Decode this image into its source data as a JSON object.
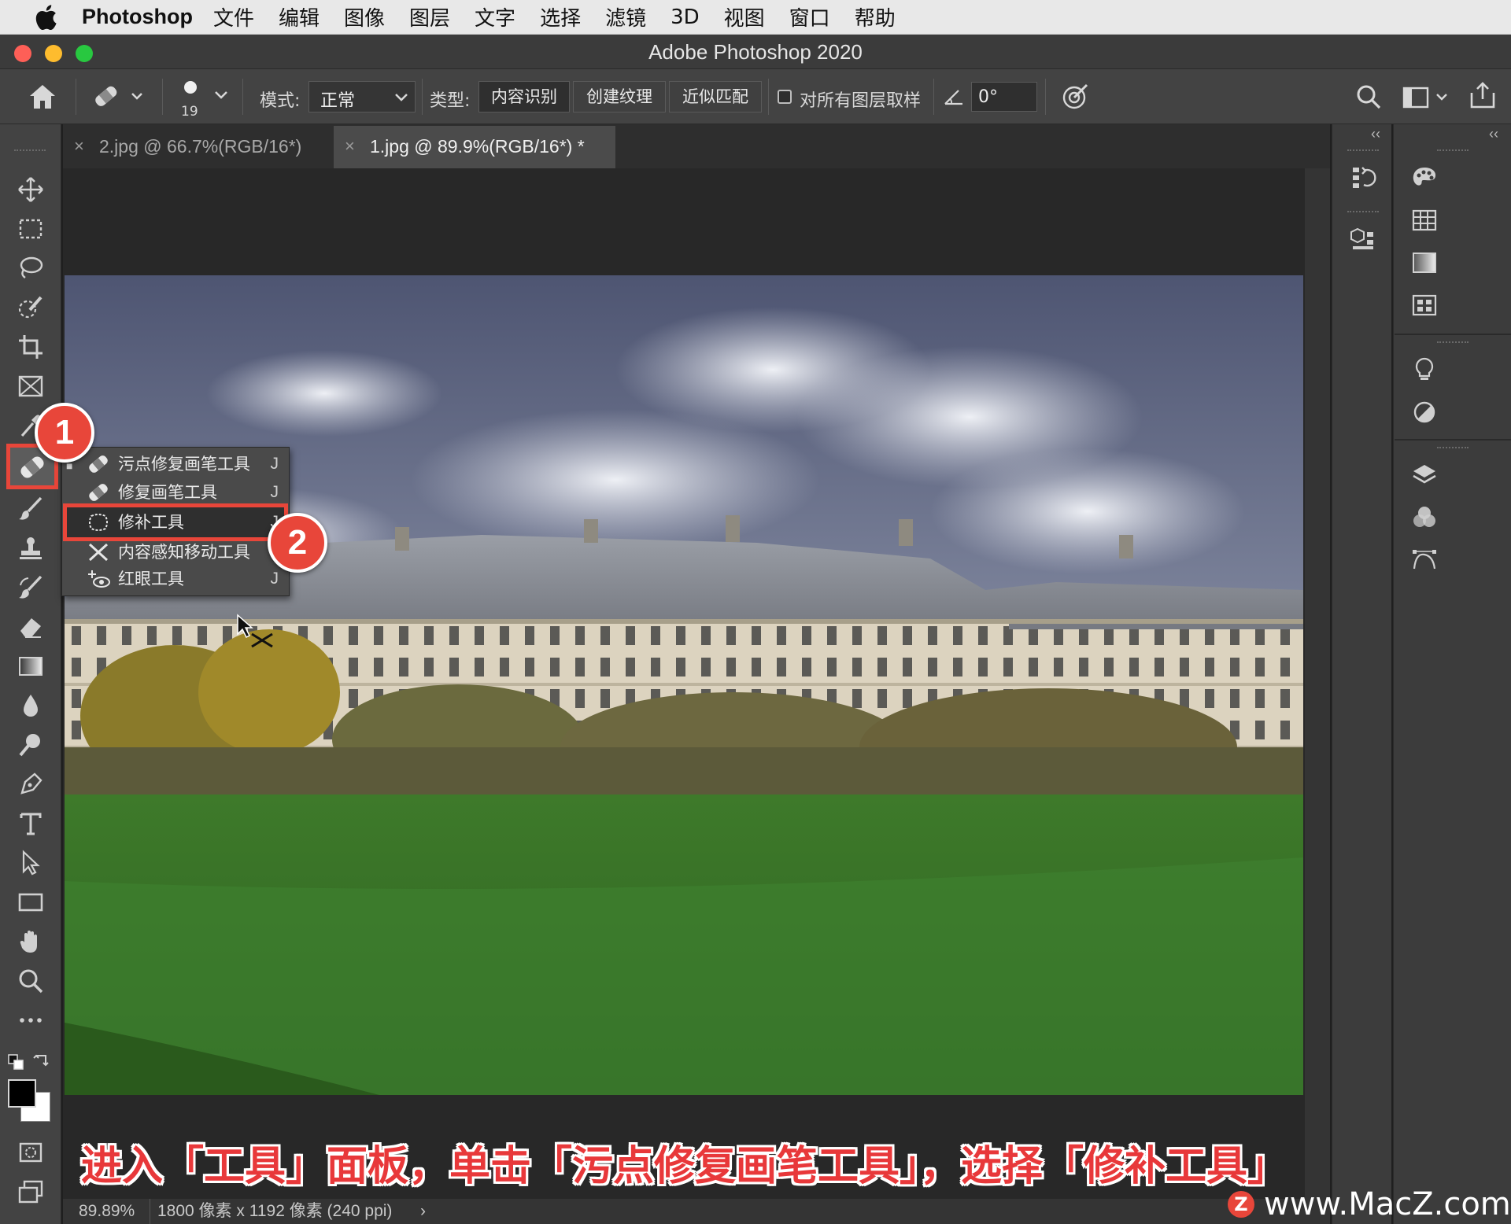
{
  "menubar": {
    "app": "Photoshop",
    "items": [
      "文件",
      "编辑",
      "图像",
      "图层",
      "文字",
      "选择",
      "滤镜",
      "3D",
      "视图",
      "窗口",
      "帮助"
    ]
  },
  "window": {
    "title": "Adobe Photoshop 2020"
  },
  "options": {
    "brush_size": "19",
    "mode_label": "模式:",
    "mode_value": "正常",
    "type_label": "类型:",
    "type_buttons": [
      "内容识别",
      "创建纹理",
      "近似匹配"
    ],
    "sample_all_label": "对所有图层取样",
    "angle_value": "0°"
  },
  "tabs": [
    {
      "label": "2.jpg @ 66.7%(RGB/16*)",
      "close": "×"
    },
    {
      "label": "1.jpg @ 89.9%(RGB/16*) *",
      "close": "×"
    }
  ],
  "flyout": {
    "items": [
      {
        "label": "污点修复画笔工具",
        "key": "J"
      },
      {
        "label": "修复画笔工具",
        "key": "J"
      },
      {
        "label": "修补工具",
        "key": "J"
      },
      {
        "label": "内容感知移动工具",
        "key": "J"
      },
      {
        "label": "红眼工具",
        "key": "J"
      }
    ]
  },
  "badges": {
    "one": "1",
    "two": "2"
  },
  "status": {
    "zoom": "89.89%",
    "info": "1800 像素 x 1192 像素 (240 ppi)",
    "arrow": "›"
  },
  "caption": "进入「工具」面板，单击「污点修复画笔工具」，选择「修补工具」",
  "watermark": {
    "text": "www.MacZ.com",
    "logo_letter": "Z"
  },
  "colors": {
    "accent_red": "#e8463a",
    "highlight_box": "#e8463a"
  }
}
